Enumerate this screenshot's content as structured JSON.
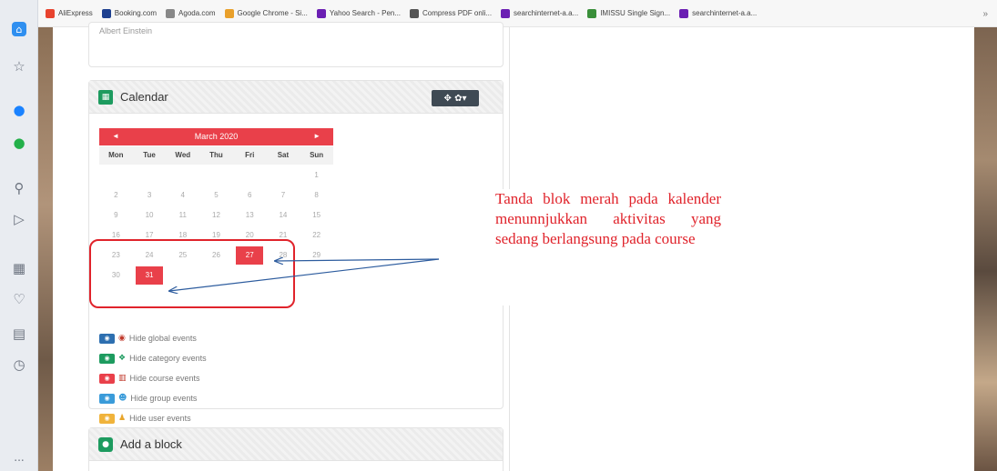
{
  "bookmarks": [
    {
      "label": "AliExpress",
      "icon": "aliexpress-icon",
      "color": "#e8432e"
    },
    {
      "label": "Booking.com",
      "icon": "booking-icon",
      "color": "#1d3f8f"
    },
    {
      "label": "Agoda.com",
      "icon": "agoda-icon",
      "color": "#888888"
    },
    {
      "label": "Google Chrome - Si...",
      "icon": "chrome-icon",
      "color": "#e9a02b"
    },
    {
      "label": "Yahoo Search - Pen...",
      "icon": "yahoo-icon",
      "color": "#6b1fb3"
    },
    {
      "label": "Compress PDF onli...",
      "icon": "document-icon",
      "color": "#555555"
    },
    {
      "label": "searchinternet-a.a...",
      "icon": "yahoo-icon",
      "color": "#6b1fb3"
    },
    {
      "label": "IMISSU Single Sign...",
      "icon": "globe-icon",
      "color": "#3a8f3a"
    },
    {
      "label": "searchinternet-a.a...",
      "icon": "yahoo-icon",
      "color": "#6b1fb3"
    }
  ],
  "bookmarks_overflow": "»",
  "sidebar_more": "...",
  "quote": "Albert Einstein",
  "calendar": {
    "title": "Calendar",
    "month": "March 2020",
    "prev": "◄",
    "next": "►",
    "controls": "✥ ✿▾",
    "weekdays": [
      "Mon",
      "Tue",
      "Wed",
      "Thu",
      "Fri",
      "Sat",
      "Sun"
    ],
    "weeks": [
      [
        "",
        "",
        "",
        "",
        "",
        "",
        "1"
      ],
      [
        "2",
        "3",
        "4",
        "5",
        "6",
        "7",
        "8"
      ],
      [
        "9",
        "10",
        "11",
        "12",
        "13",
        "14",
        "15"
      ],
      [
        "16",
        "17",
        "18",
        "19",
        "20",
        "21",
        "22"
      ],
      [
        "23",
        "24",
        "25",
        "26",
        "27",
        "28",
        "29"
      ],
      [
        "30",
        "31",
        "",
        "",
        "",
        "",
        ""
      ]
    ],
    "event_days": [
      "27",
      "31"
    ],
    "event_color": "#e9404a"
  },
  "legend": [
    {
      "label": "Hide global events",
      "eye_color": "#2d6fb0",
      "icon": "globe-icon",
      "icon_char": "◉",
      "icon_color": "#c0392b"
    },
    {
      "label": "Hide category events",
      "eye_color": "#1d9b5f",
      "icon": "cubes-icon",
      "icon_char": "❖",
      "icon_color": "#1d9b5f"
    },
    {
      "label": "Hide course events",
      "eye_color": "#e9404a",
      "icon": "institution-icon",
      "icon_char": "▥",
      "icon_color": "#c0392b"
    },
    {
      "label": "Hide group events",
      "eye_color": "#3a9bd9",
      "icon": "users-icon",
      "icon_char": "☻",
      "icon_color": "#3a9bd9"
    },
    {
      "label": "Hide user events",
      "eye_color": "#f0b33b",
      "icon": "user-icon",
      "icon_char": "♟",
      "icon_color": "#e8a52b"
    }
  ],
  "add_block": {
    "title": "Add a block"
  },
  "annotation": "Tanda blok merah pada kalender menunnjukkan aktivitas yang sedang berlangsung pada course",
  "annotation_color": "#e0232b"
}
